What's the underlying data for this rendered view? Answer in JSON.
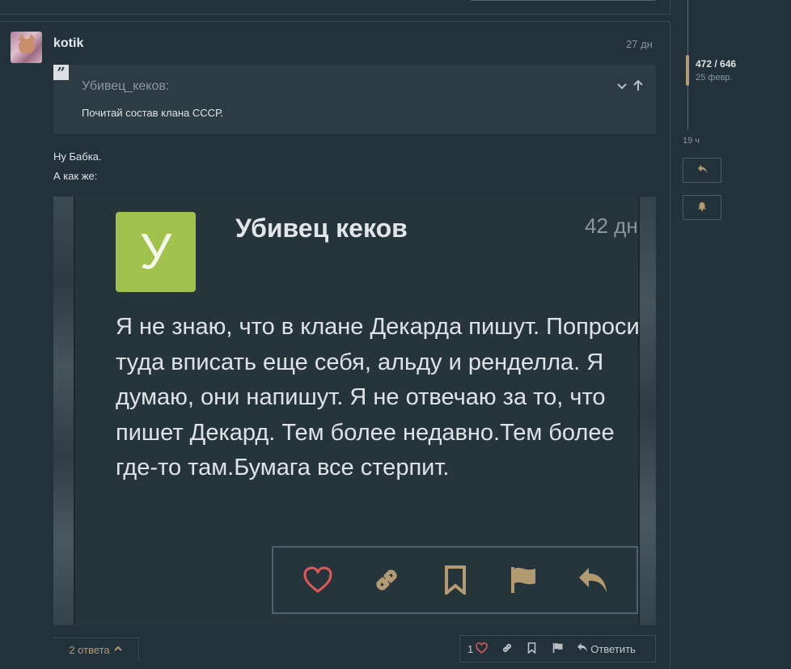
{
  "post": {
    "username": "kotik",
    "date": "27 дн",
    "quote": {
      "author": "Убивец_кеков:",
      "text": "Почитай состав клана СССР."
    },
    "body_lines": [
      "Ну Бабка.",
      "А как же:"
    ],
    "embed": {
      "avatar_letter": "У",
      "author": "Убивец кеков",
      "date": "42 дн",
      "text": "Я не знаю, что в клане Декарда пишут. Попроси туда вписать еще себя, альду и ренделла. Я думаю, они напишут. Я не отвечаю за то, что пишет Декард. Тем более недавно.Тем более где-то там.Бумага все стерпит."
    },
    "replies_label": "2 ответа",
    "likes_count": "1",
    "reply_label": "Ответить"
  },
  "timeline": {
    "position": "472 / 646",
    "date": "25 февр.",
    "ago": "19 ч"
  },
  "colors": {
    "background": "#22313a",
    "accent": "#b39a70",
    "like": "#e45757",
    "avatar_bg": "#a2c24e"
  }
}
